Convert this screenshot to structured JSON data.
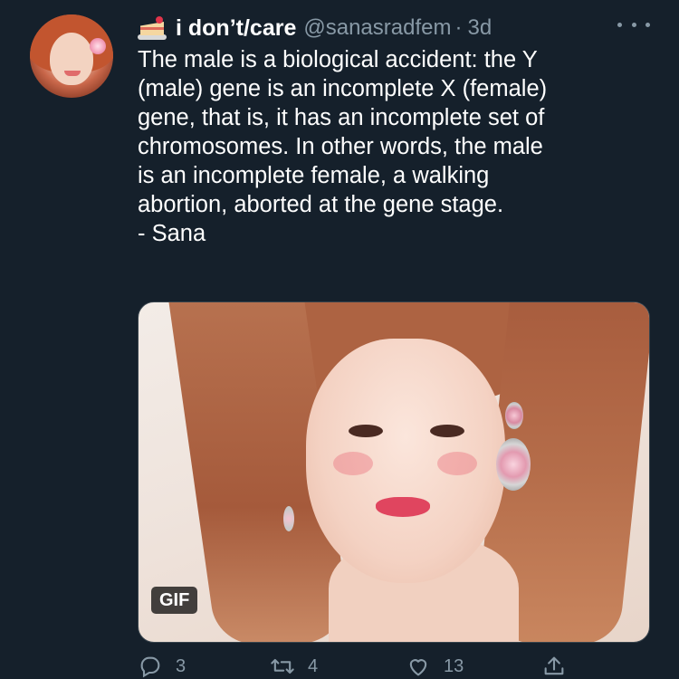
{
  "tweet": {
    "emoji": "cake",
    "display_name": "i don’t/care",
    "handle": "@sanasradfem",
    "separator": "·",
    "time": "3d",
    "text": "The male is a biological accident: the Y\n(male) gene is an incomplete X (female)\ngene, that is, it has an incomplete set of\nchromosomes. In other words, the male\nis an incomplete female, a walking\nabortion, aborted at the gene stage.\n- Sana",
    "media_badge": "GIF"
  },
  "actions": {
    "reply_count": "3",
    "retweet_count": "4",
    "like_count": "13",
    "icons": [
      "reply-icon",
      "retweet-icon",
      "heart-icon",
      "share-icon"
    ]
  },
  "colors": {
    "background": "#15202b",
    "secondary_text": "#8899a6",
    "primary_text": "#ffffff"
  }
}
